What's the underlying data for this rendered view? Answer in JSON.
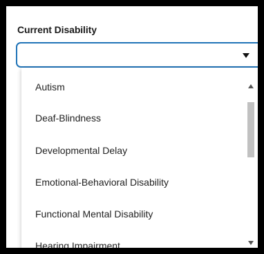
{
  "field": {
    "label": "Current Disability",
    "value": "",
    "focus_color": "#1f73b7"
  },
  "dropdown": {
    "options": [
      "Autism",
      "Deaf-Blindness",
      "Developmental Delay",
      "Emotional-Behavioral Disability",
      "Functional Mental Disability",
      "Hearing Impairment"
    ]
  },
  "icons": {
    "select_caret": "chevron-down-icon",
    "scroll_up": "arrow-up-icon",
    "scroll_down": "arrow-down-icon"
  }
}
